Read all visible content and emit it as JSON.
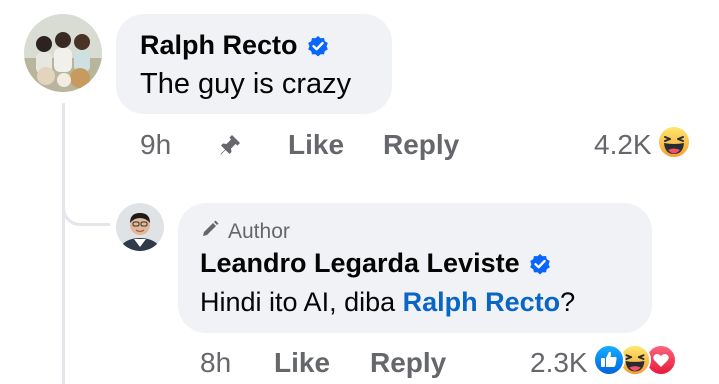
{
  "comment": {
    "author": "Ralph Recto",
    "text": "The guy is crazy",
    "time": "9h",
    "like_label": "Like",
    "reply_label": "Reply",
    "reaction_count": "4.2K",
    "reaction_icons": [
      "haha-icon"
    ]
  },
  "reply": {
    "badge": "Author",
    "author": "Leandro Legarda Leviste",
    "text_before": "Hindi ito AI, diba ",
    "mention": "Ralph Recto",
    "text_after": "?",
    "time": "8h",
    "like_label": "Like",
    "reply_label": "Reply",
    "reaction_count": "2.3K",
    "reaction_icons": [
      "like-icon",
      "haha-icon",
      "love-icon"
    ]
  },
  "colors": {
    "bubble": "#f0f2f5",
    "verified": "#0866ff",
    "mention": "#0866c6",
    "meta": "#65676b",
    "thread_line": "#e4e6eb"
  }
}
